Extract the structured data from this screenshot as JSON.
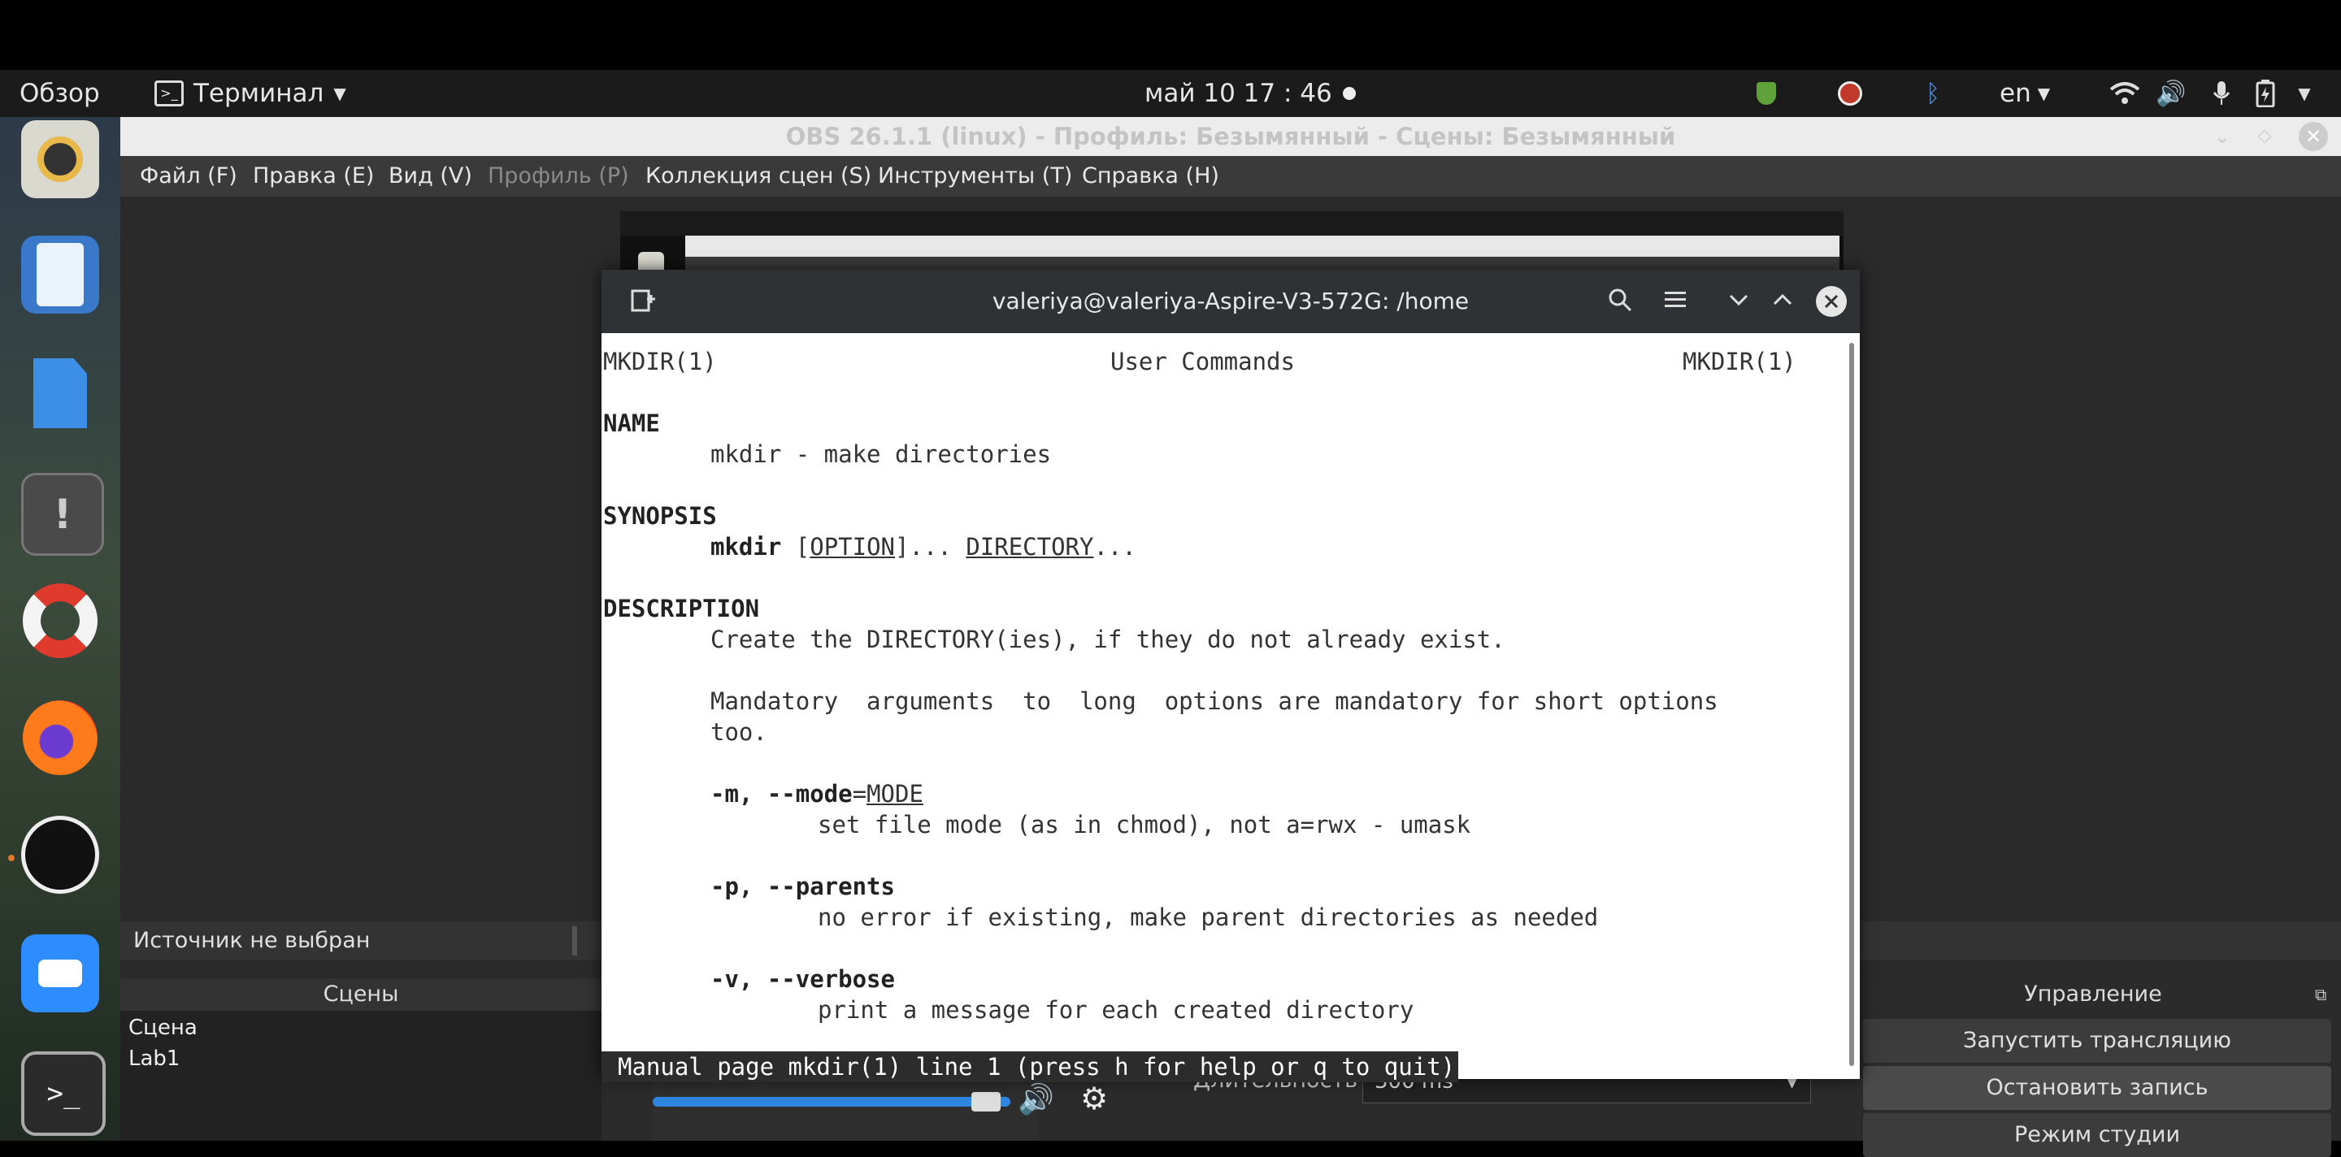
{
  "topbar": {
    "overview": "Обзор",
    "app_menu": "Терминал",
    "clock": "май 10 17 : 46",
    "keyboard_layout": "en"
  },
  "obs": {
    "title": "OBS 26.1.1 (linux) - Профиль: Безымянный - Сцены: Безымянный",
    "menu": [
      "Файл (F)",
      "Правка (E)",
      "Вид (V)",
      "Профиль (P)",
      "Коллекция сцен (S)",
      "Инструменты (T)",
      "Справка (H)"
    ],
    "no_source": "Источник не выбран",
    "scenes_header": "Сцены",
    "scenes": [
      "Сцена",
      "Lab1"
    ],
    "duration_label": "Длительность",
    "duration_value": "300 ms",
    "controls_header": "Управление",
    "controls": [
      "Запустить трансляцию",
      "Остановить запись",
      "Режим студии"
    ]
  },
  "terminal": {
    "title": "valeriya@valeriya-Aspire-V3-572G: /home",
    "man": {
      "header_left": "MKDIR(1)",
      "header_center": "User Commands",
      "header_right": "MKDIR(1)",
      "name_h": "NAME",
      "name_desc": "mkdir - make directories",
      "synopsis_h": "SYNOPSIS",
      "syn_cmd": "mkdir",
      "syn_option": "OPTION",
      "syn_mid": "]... ",
      "syn_dir": "DIRECTORY",
      "syn_end": "...",
      "description_h": "DESCRIPTION",
      "desc1": "Create the DIRECTORY(ies), if they do not already exist.",
      "desc2": "Mandatory  arguments  to  long  options are mandatory for short options",
      "desc3": "too.",
      "opt_m": "-m, --mode",
      "opt_m_arg": "MODE",
      "opt_m_desc": "set file mode (as in chmod), not a=rwx - umask",
      "opt_p": "-p, --parents",
      "opt_p_desc": "no error if existing, make parent directories as needed",
      "opt_v": "-v, --verbose",
      "opt_v_desc": "print a message for each created directory",
      "status": "Manual page mkdir(1) line 1 (press h for help or q to quit)"
    }
  },
  "colors": {
    "terminal_header": "#2f3234",
    "obs_bg": "#2b2b2b",
    "status_bg": "#2c2c2c"
  }
}
